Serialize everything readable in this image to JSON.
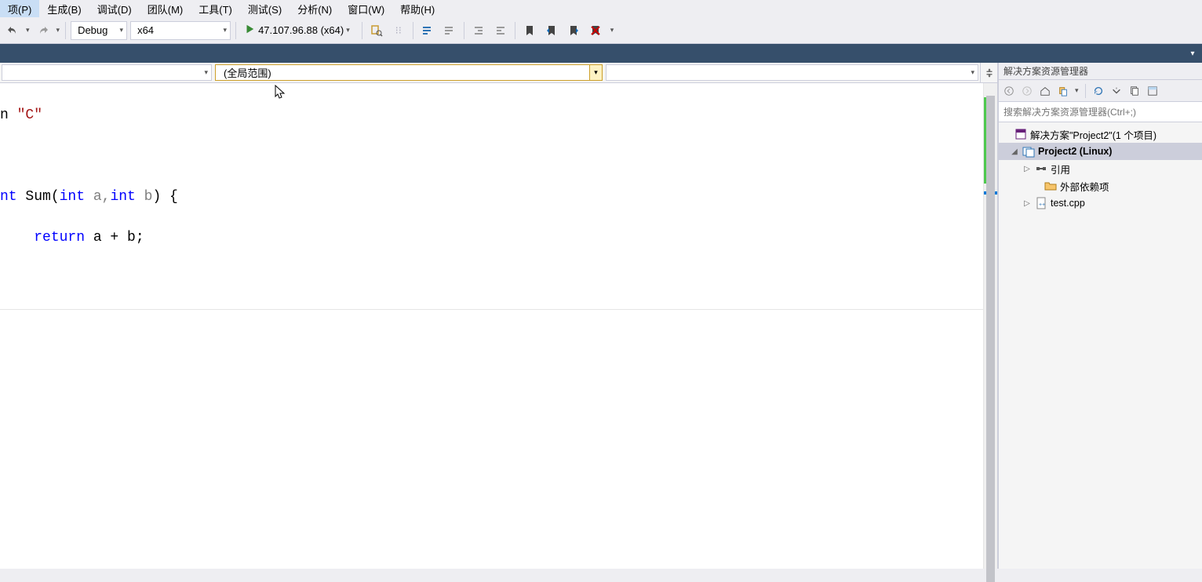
{
  "menu": {
    "items": [
      "项(P)",
      "生成(B)",
      "调试(D)",
      "团队(M)",
      "工具(T)",
      "测试(S)",
      "分析(N)",
      "窗口(W)",
      "帮助(H)"
    ]
  },
  "toolbar": {
    "config": "Debug",
    "platform": "x64",
    "start_target": "47.107.96.88 (x64)"
  },
  "nav": {
    "scope": "(全局范围)"
  },
  "code": {
    "line1_a": "n ",
    "line1_b": "\"C\"",
    "line3_a": "nt ",
    "line3_b": "Sum",
    "line3_c": "(",
    "line3_d": "int",
    "line3_e": " a,",
    "line3_f": "int",
    "line3_g": " b",
    "line3_h": ") {",
    "line4_a": "    ",
    "line4_b": "return",
    "line4_c": " a + b;"
  },
  "panel": {
    "title": "解决方案资源管理器",
    "search_placeholder": "搜索解决方案资源管理器(Ctrl+;)"
  },
  "tree": {
    "solution": "解决方案\"Project2\"(1 个项目)",
    "project": "Project2 (Linux)",
    "refs": "引用",
    "extdeps": "外部依赖项",
    "file": "test.cpp"
  }
}
